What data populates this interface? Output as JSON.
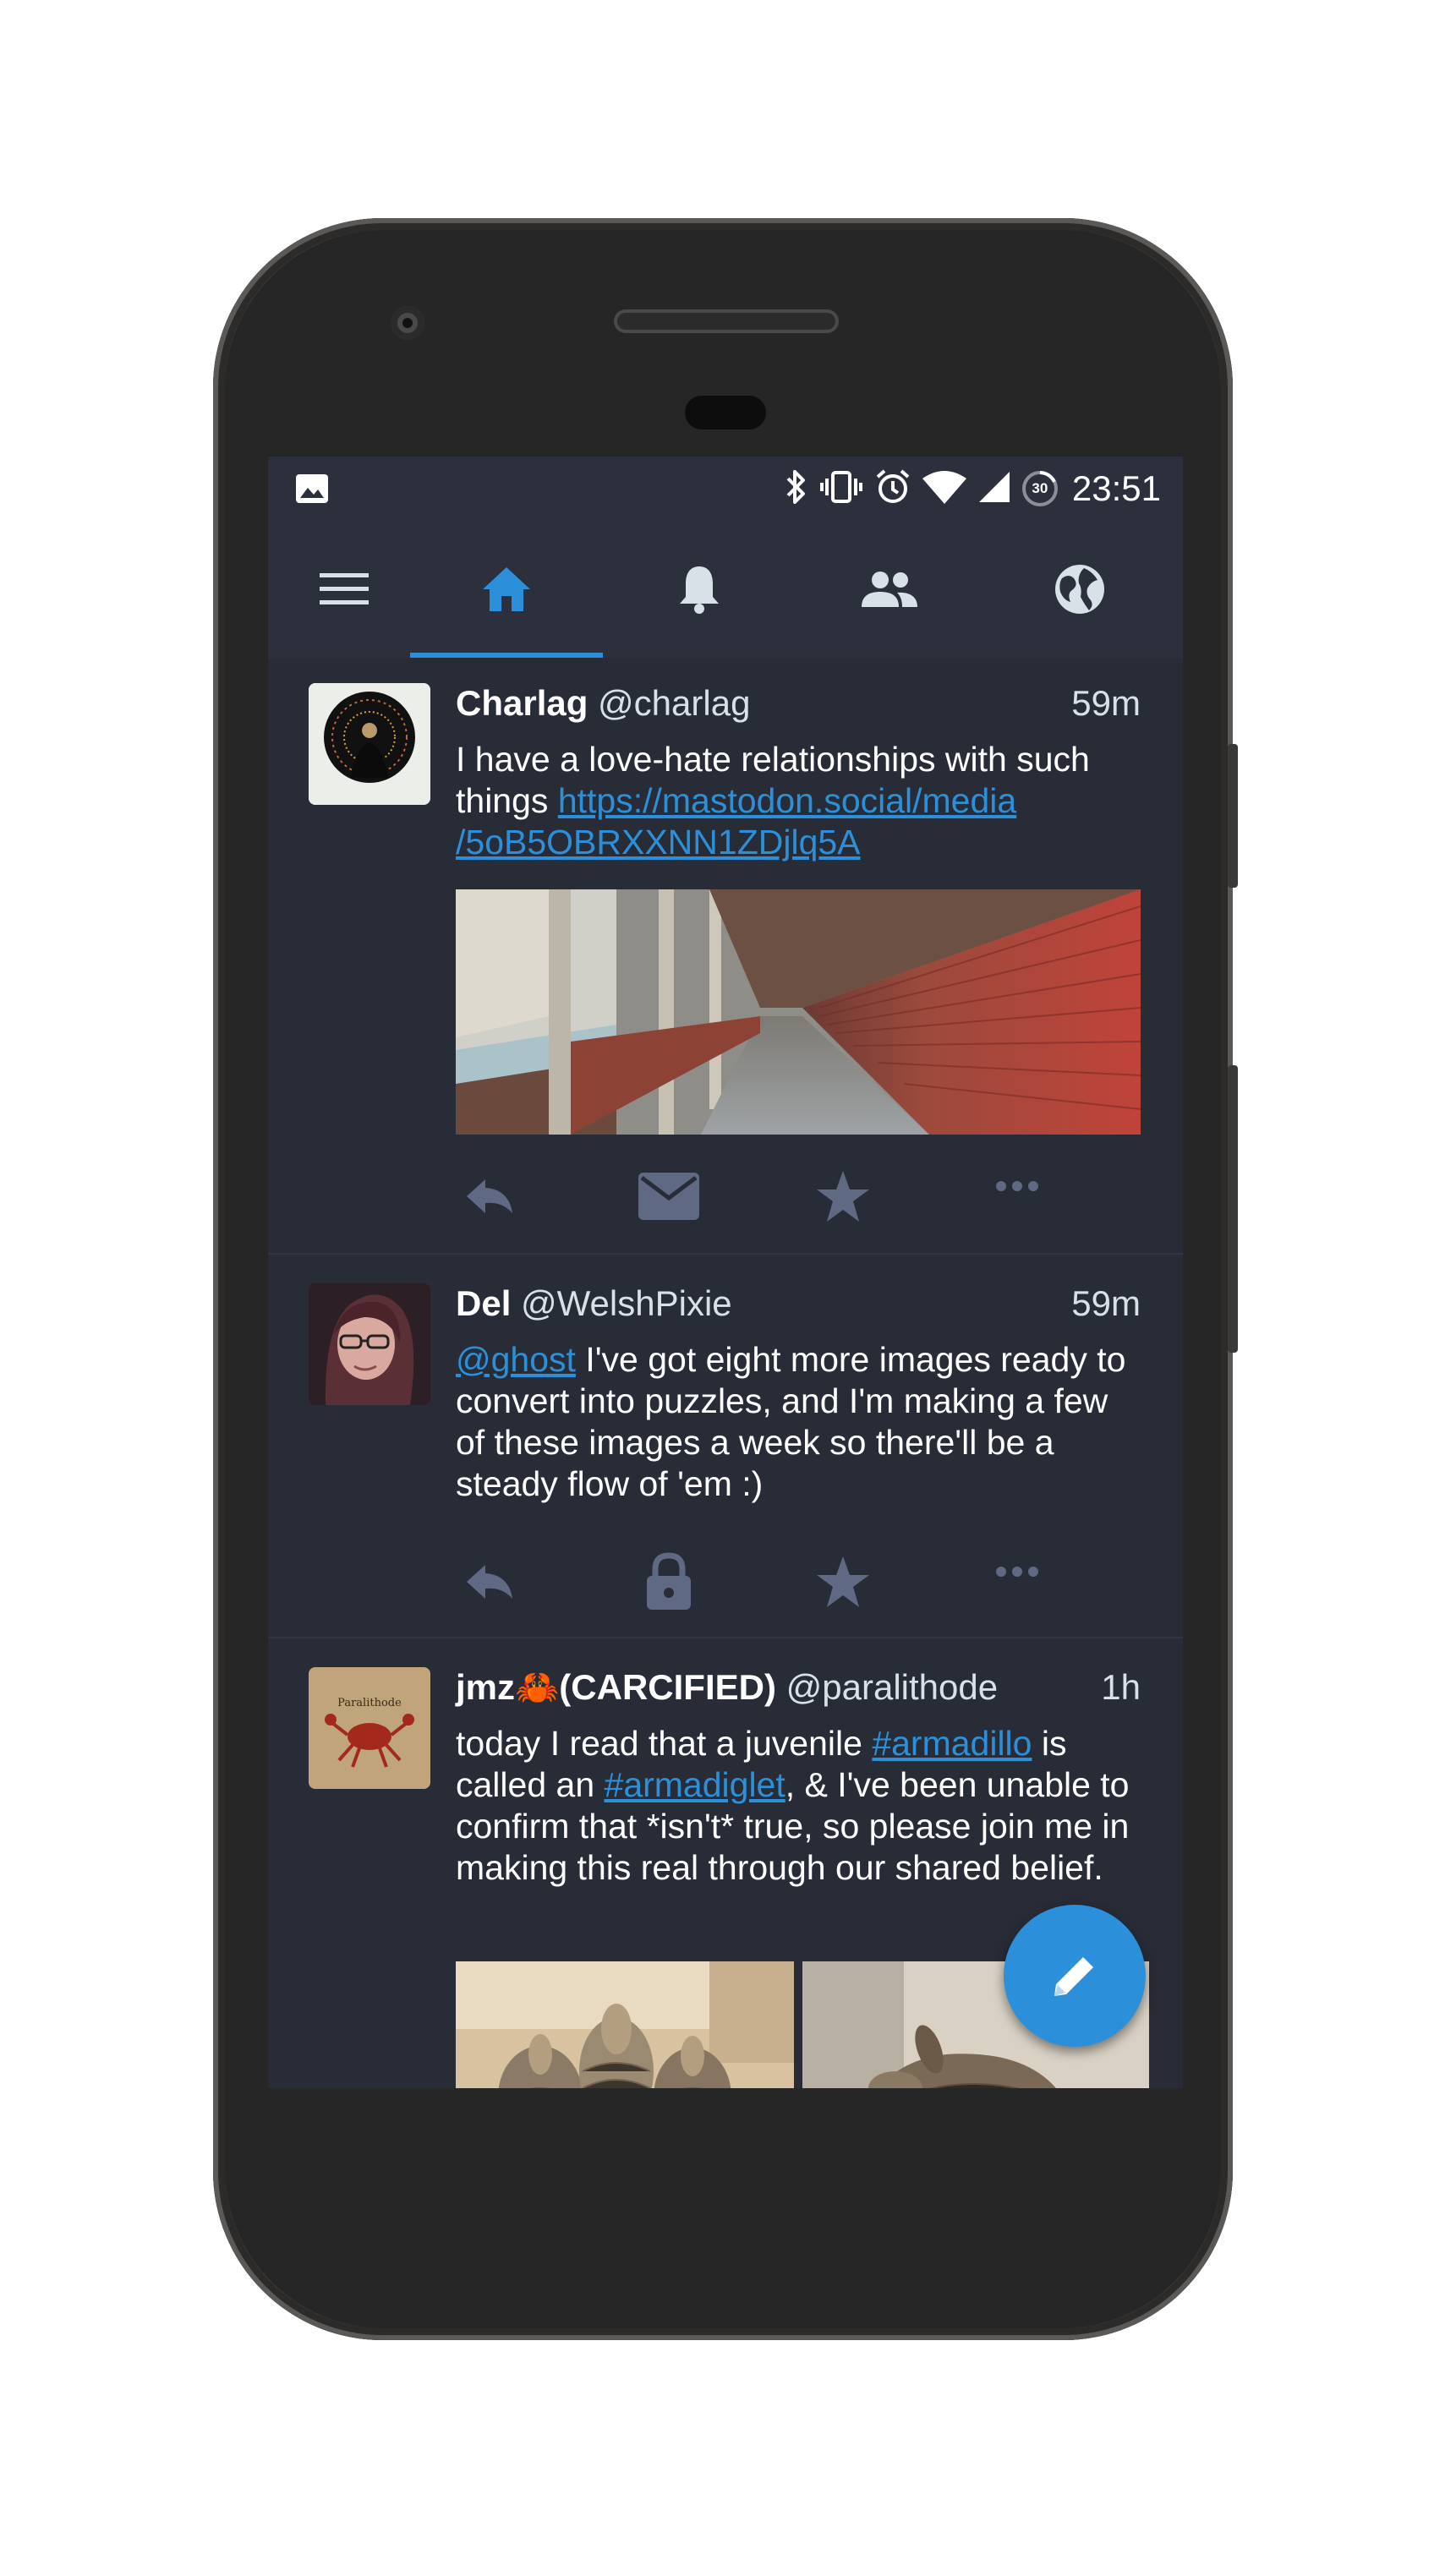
{
  "statusbar": {
    "time": "23:51",
    "battery_level": "30",
    "icons": [
      "image-icon",
      "bluetooth-icon",
      "vibrate-icon",
      "alarm-icon",
      "wifi-icon",
      "signal-icon",
      "battery-icon"
    ]
  },
  "tabs": [
    {
      "name": "menu",
      "icon": "hamburger-menu-icon",
      "active": false
    },
    {
      "name": "home",
      "icon": "home-icon",
      "active": true
    },
    {
      "name": "notifications",
      "icon": "bell-icon",
      "active": false
    },
    {
      "name": "local",
      "icon": "people-icon",
      "active": false
    },
    {
      "name": "federated",
      "icon": "globe-icon",
      "active": false
    }
  ],
  "colors": {
    "accent": "#2b90d9",
    "background": "#282c37",
    "bar": "#2b303c",
    "action_icon": "#606984"
  },
  "statuses": [
    {
      "display_name": "Charlag",
      "acct": "@charlag",
      "time": "59m",
      "text_1": "I have a love-hate relationships with such things ",
      "link": "https://mastodon.social/media/5oB5OBRXXNN1ZDjlq5A",
      "link_line1": "https://mastodon.social/media",
      "link_line2": "/5oB5OBRXXNN1ZDjlq5A",
      "media": [
        "corridor-photo"
      ],
      "actions": [
        "reply-icon",
        "direct-message-icon",
        "star-icon",
        "more-icon"
      ]
    },
    {
      "display_name": "Del",
      "acct": "@WelshPixie",
      "time": "59m",
      "mention": "@ghost",
      "text_1": " I've got eight more images ready to convert into puzzles, and I'm making a few of these images a week so there'll be a steady flow of 'em :)",
      "actions": [
        "reply-icon",
        "lock-icon",
        "star-icon",
        "more-icon"
      ]
    },
    {
      "display_name": "jmz🦀(CARCIFIED)",
      "acct": "@paralithode",
      "time": "1h",
      "text_1": "today I read that a juvenile ",
      "hashtag_1": "#armadillo",
      "text_2": " is called an ",
      "hashtag_2": "#armadiglet",
      "text_3": ", & I've been unable to confirm that *isn't* true, so please join me in making this real through our shared belief.",
      "media": [
        "armadillo-photo-1",
        "armadillo-photo-2"
      ]
    }
  ],
  "fab": {
    "icon": "pencil-icon"
  }
}
